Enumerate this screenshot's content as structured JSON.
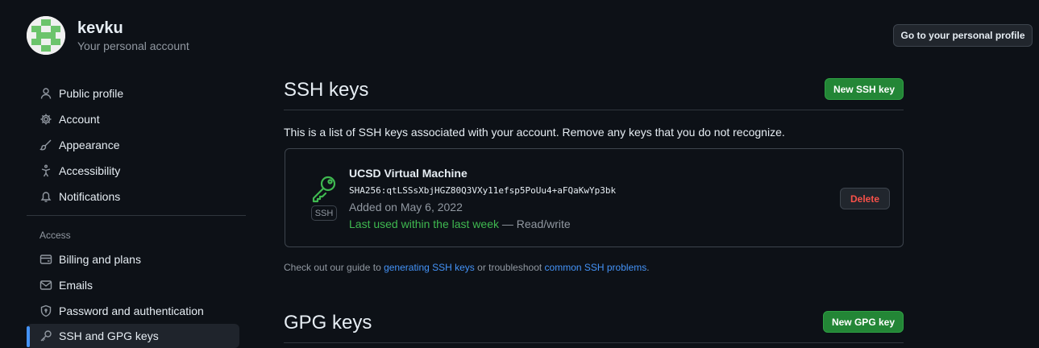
{
  "header": {
    "username": "kevku",
    "subtitle": "Your personal account",
    "profile_button": "Go to your personal profile"
  },
  "sidebar": {
    "items": [
      {
        "label": "Public profile",
        "icon": "person-icon"
      },
      {
        "label": "Account",
        "icon": "gear-icon"
      },
      {
        "label": "Appearance",
        "icon": "paintbrush-icon"
      },
      {
        "label": "Accessibility",
        "icon": "accessibility-icon"
      },
      {
        "label": "Notifications",
        "icon": "bell-icon"
      }
    ],
    "access_heading": "Access",
    "access_items": [
      {
        "label": "Billing and plans",
        "icon": "credit-card-icon"
      },
      {
        "label": "Emails",
        "icon": "mail-icon"
      },
      {
        "label": "Password and authentication",
        "icon": "shield-lock-icon"
      },
      {
        "label": "SSH and GPG keys",
        "icon": "key-icon",
        "active": true
      }
    ]
  },
  "ssh": {
    "title": "SSH keys",
    "new_button": "New SSH key",
    "description": "This is a list of SSH keys associated with your account. Remove any keys that you do not recognize.",
    "key": {
      "name": "UCSD Virtual Machine",
      "fingerprint": "SHA256:qtLSSsXbjHGZ80Q3VXy11efsp5PoUu4+aFQaKwYp3bk",
      "added": "Added on May 6, 2022",
      "last_used": "Last used within the last week",
      "access": " — Read/write",
      "badge": "SSH",
      "delete_button": "Delete"
    },
    "guide": {
      "prefix": "Check out our guide to ",
      "link1": "generating SSH keys",
      "middle": " or troubleshoot ",
      "link2": "common SSH problems",
      "suffix": "."
    }
  },
  "gpg": {
    "title": "GPG keys",
    "new_button": "New GPG key"
  },
  "colors": {
    "background": "#0d1117",
    "primary_button": "#238636",
    "link": "#4493f8",
    "success": "#3fb950",
    "danger": "#f85149"
  }
}
